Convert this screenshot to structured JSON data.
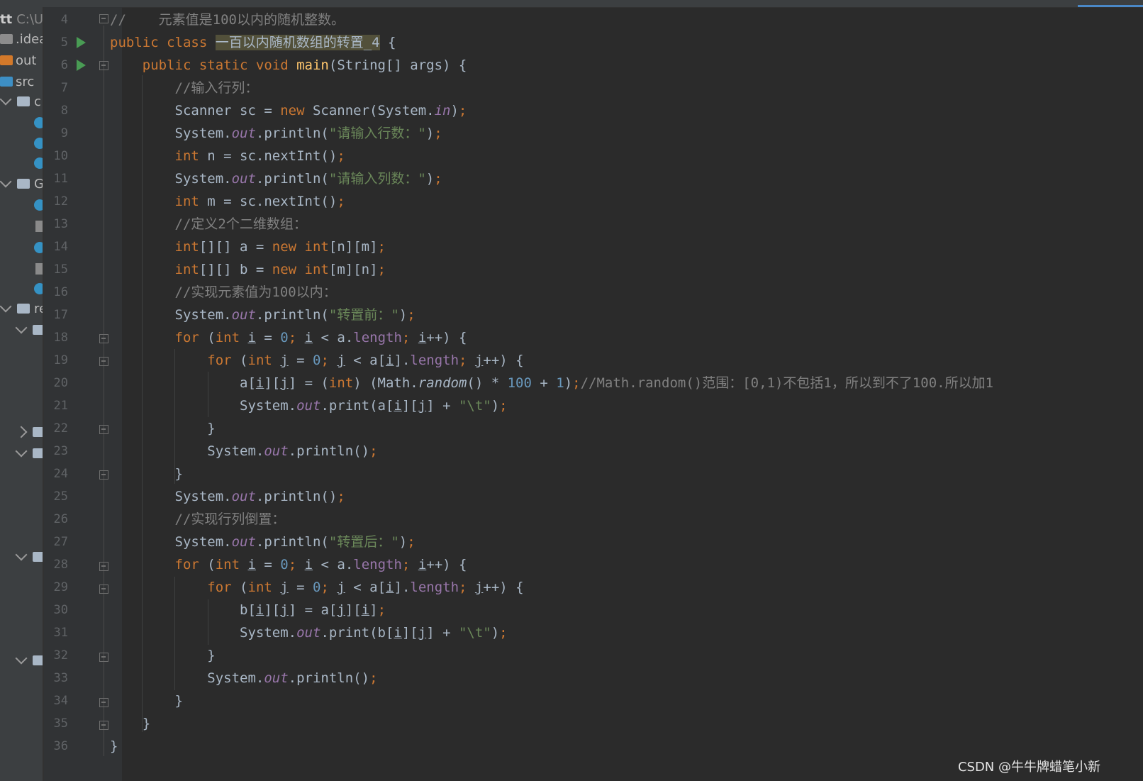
{
  "project_tree": {
    "root": "tt",
    "root_path": "C:\\Us",
    "items": [
      ".idea",
      "out",
      "src",
      "c",
      "G",
      "re"
    ]
  },
  "editor": {
    "line_numbers": [
      "4",
      "5",
      "6",
      "7",
      "8",
      "9",
      "10",
      "11",
      "12",
      "13",
      "14",
      "15",
      "16",
      "17",
      "18",
      "19",
      "20",
      "21",
      "22",
      "23",
      "24",
      "25",
      "26",
      "27",
      "28",
      "29",
      "30",
      "31",
      "32",
      "33",
      "34",
      "35",
      "36"
    ],
    "lines": {
      "l4_comment": "//    元素值是100以内的随机整数。",
      "l5_class_name": "一百以内随机数组的转置_4",
      "l7_comment": "//输入行列：",
      "l9_prompt": "\"请输入行数：\"",
      "l11_prompt": "\"请输入列数：\"",
      "l13_comment": "//定义2个二维数组：",
      "l16_comment": "//实现元素值为100以内：",
      "l17_label": "\"转置前：\"",
      "l20_comment": "//Math.random()范围：[0,1)不包括1，所以到不了100.所以加1",
      "l21_tab": "\"\\t\"",
      "l26_comment": "//实现行列倒置：",
      "l27_label": "\"转置后：\"",
      "l31_tab": "\"\\t\""
    }
  },
  "watermark": "CSDN @牛牛牌蜡笔小新",
  "colors": {
    "background": "#2b2b2b",
    "keyword": "#cc7832",
    "function": "#ffc66d",
    "number": "#6897bb",
    "string": "#6a8759",
    "comment": "#808080",
    "field": "#9876aa",
    "run_icon": "#499c54"
  }
}
